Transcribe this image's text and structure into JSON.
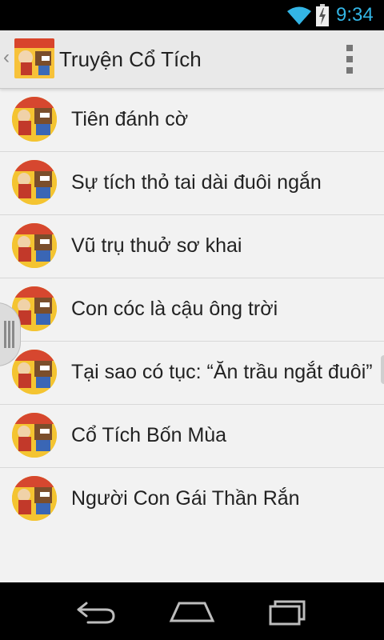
{
  "status_bar": {
    "time": "9:34",
    "wifi_icon": "wifi-icon",
    "battery_icon": "battery-charging-icon",
    "accent_color": "#33b5e5"
  },
  "action_bar": {
    "title": "Truyện Cổ Tích",
    "up_icon": "up-caret-icon",
    "overflow_icon": "overflow-menu-icon"
  },
  "stories": [
    {
      "title": "Tiên đánh cờ"
    },
    {
      "title": "Sự tích thỏ tai dài đuôi ngắn"
    },
    {
      "title": "Vũ trụ thuở sơ khai"
    },
    {
      "title": "Con cóc là cậu ông trời"
    },
    {
      "title": "Tại sao có tục: “Ăn trầu ngắt đuôi”"
    },
    {
      "title": "Cổ Tích Bốn Mùa"
    },
    {
      "title": "Người Con Gái Thần Rắn"
    }
  ],
  "nav_bar": {
    "back_icon": "back-icon",
    "home_icon": "home-icon",
    "recents_icon": "recents-icon"
  }
}
